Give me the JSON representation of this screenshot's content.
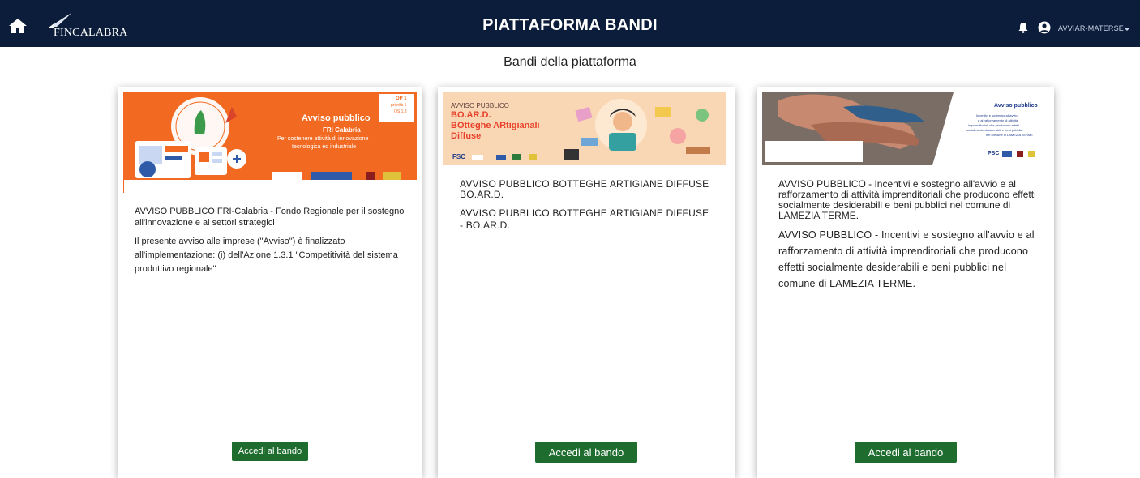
{
  "header": {
    "logo_text": "FINCALABRA",
    "title": "PIATTAFORMA BANDI",
    "user_name": "AVVIAR-MATERSE",
    "icons": {
      "home": "home-icon",
      "notifications": "bell-icon",
      "account": "user-circle-icon",
      "menu": "chevron-down-icon"
    }
  },
  "page": {
    "subtitle": "Bandi della piattaforma"
  },
  "colors": {
    "header_bg": "#0b1d3a",
    "button_bg": "#1e6d2f",
    "banner1_bg": "#f26a21",
    "banner2_bg": "#f9d7b4"
  },
  "cards": [
    {
      "banner": {
        "heading": "Avviso pubblico",
        "subheading": "FRI Calabria",
        "line1": "Per sostenere attività di innovazione",
        "line2": "tecnologica ed industriale",
        "tag1": "OP 1",
        "tag2": "priorità 1",
        "tag3": "OS 1.3"
      },
      "title": "AVVISO PUBBLICO FRI-Calabria - Fondo Regionale per il sostegno all'innovazione e ai settori strategici",
      "description": "Il presente avviso alle imprese (\"Avviso\") è finalizzato all'implementazione: (i) dell'Azione 1.3.1 \"Competitività del sistema produttivo regionale\"",
      "button_label": "Accedi al bando"
    },
    {
      "banner": {
        "heading": "AVVISO PUBBLICO",
        "line1": "BO.AR.D.",
        "line2": "BOtteghe ARtigianali",
        "line3": "Diffuse",
        "footer": "FSC"
      },
      "title": "AVVISO PUBBLICO BOTTEGHE ARTIGIANE DIFFUSE   BO.AR.D.",
      "description": "AVVISO PUBBLICO BOTTEGHE ARTIGIANE DIFFUSE - BO.AR.D.",
      "button_label": "Accedi al bando"
    },
    {
      "banner": {
        "heading": "Avviso pubblico",
        "line1": "Incentivi e sostegno all'avvio",
        "line2": "e al rafforzamento di attività",
        "line3": "imprenditoriali che producono effetti",
        "line4": "socialmente desiderabili e beni pubblici",
        "line5": "nel comune di LAMEZIA TERME",
        "footer": "PSC"
      },
      "title": "AVVISO PUBBLICO - Incentivi e sostegno all'avvio e al rafforzamento di attività imprenditoriali che producono effetti socialmente desiderabili e beni pubblici nel comune di LAMEZIA TERME.",
      "description": "AVVISO PUBBLICO - Incentivi e sostegno all'avvio e al rafforzamento di attività imprenditoriali che producono effetti socialmente desiderabili e beni pubblici nel comune di LAMEZIA TERME.",
      "button_label": "Accedi al bando"
    }
  ]
}
